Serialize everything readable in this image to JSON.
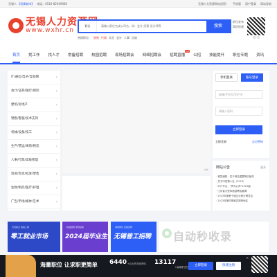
{
  "topbar": {
    "site": "无锡人",
    "switch": "【切换城市】",
    "phone": "电话：0510-82949080",
    "links": [
      "无锡人力资源网欢迎您！",
      "手机版",
      "用户登录",
      "网站导航"
    ]
  },
  "logo": {
    "cn": "无锡人力资源网",
    "en": "www.wxhr.cn"
  },
  "search": {
    "scope": "职位",
    "placeholder": "请输入职位名或公司名，如：会计 经理 设计师等",
    "button": "搜索",
    "hot_label": "热搜职位：",
    "hot": [
      "销售",
      "行政",
      "文员",
      "会计",
      "人事",
      "出纳"
    ],
    "side_links": [
      "职位发布",
      "简历投递"
    ]
  },
  "qr": {
    "caption": "扫一扫"
  },
  "nav": [
    {
      "label": "首页",
      "active": true
    },
    {
      "label": "找工作"
    },
    {
      "label": "找人才"
    },
    {
      "label": "常备招聘"
    },
    {
      "label": "校园招聘"
    },
    {
      "label": "现场招聘会"
    },
    {
      "label": "网络招聘会"
    },
    {
      "label": "招聘直播",
      "badge": "hot"
    },
    {
      "label": "公招"
    },
    {
      "label": "技能提升"
    },
    {
      "label": "职位专题"
    },
    {
      "label": "资讯"
    }
  ],
  "categories": [
    "IT/通信/电子/互联网",
    "会计/证券/银行/保险",
    "建筑/房地产",
    "销售/客服/技术支持",
    "机械/设备/技工",
    "生产/营运/采购/物流",
    "人事/行政/高级管理",
    "贸易/百货/批发/零售",
    "生物/制药/医疗/护理",
    "广告/市场/媒体/艺术"
  ],
  "banner": {
    "tag": "1/6"
  },
  "login": {
    "tab_phone": "手机登录",
    "tab_account": "账号登录",
    "user_placeholder": "邮箱/手机号/用户名",
    "pass_placeholder": "请输入密码",
    "submit": "立即登录",
    "register": "立即注册",
    "forgot": "忘记密码"
  },
  "notice": {
    "title": "网站公告",
    "more": "更多",
    "items": [
      {
        "tag": "·",
        "text": "紧急通知：关于网站重要简历被改"
      },
      {
        "tag": "·",
        "text": "关于印发锡人社〔2023〕"
      },
      {
        "tag": "·",
        "text": "中介节点，“梦为心声”2023届"
      },
      {
        "tag": "·",
        "text": "江苏省大型体面招聘会圆满"
      },
      {
        "tag": "·",
        "text": "2023年度第十届企业就业博览会"
      },
      {
        "tag": "·",
        "text": "2023年第四季度苏锡常地区"
      }
    ]
  },
  "ads": [
    {
      "title": "零工就业市场",
      "sub": "灵活就业 快速上岗"
    },
    {
      "title": "2024届毕业生",
      "sub": "校园招聘 梦想启航"
    },
    {
      "title": "无锡普工招聘",
      "sub": "海量岗位 直招直聘"
    }
  ],
  "watermark": "自动秒收录",
  "footbar": {
    "slogan": "海量职位 让求职更简单",
    "jobs_num": "6440",
    "jobs_label": "+企业的在线职位",
    "resume_num": "13117",
    "resume_label": "+高端职位任您挑选",
    "login": "立即登录",
    "register": "快速注册",
    "close": "×"
  }
}
